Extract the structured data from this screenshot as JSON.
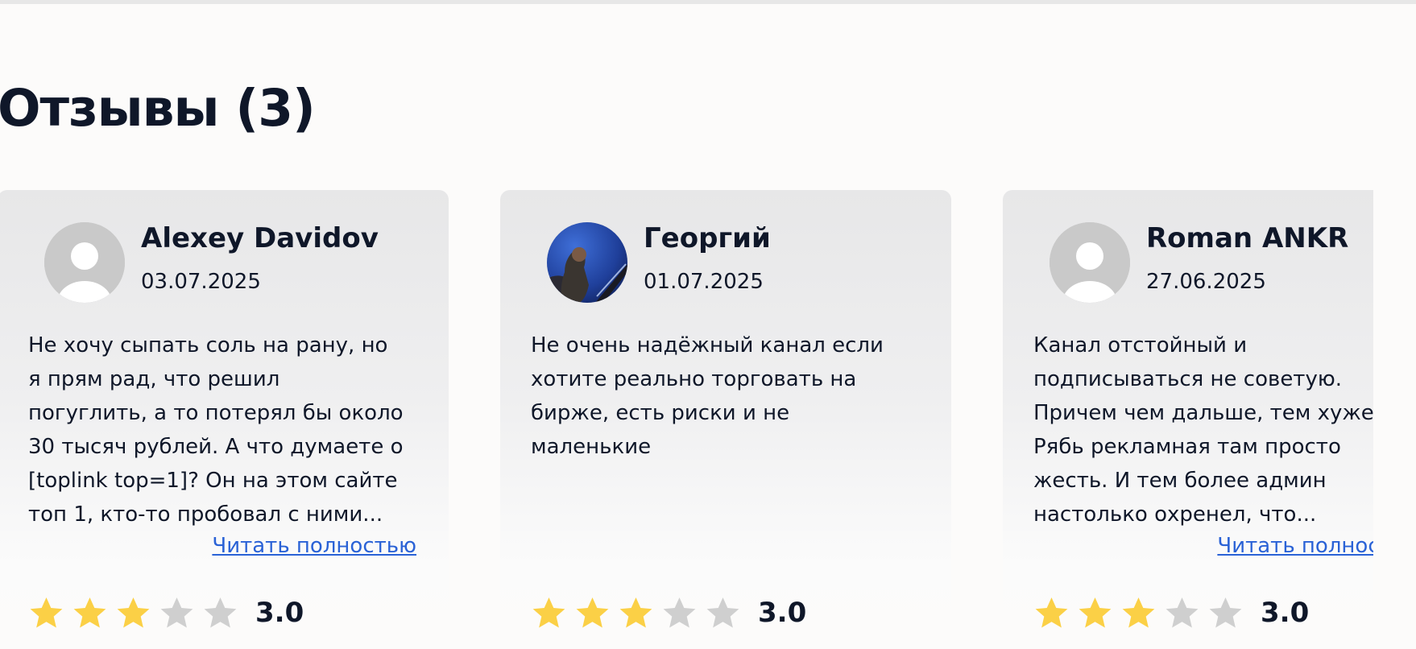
{
  "section": {
    "title": "Отзывы (3)"
  },
  "colors": {
    "star_filled": "#fbd046",
    "star_empty": "#cfcfcf",
    "link": "#2a62d6",
    "text": "#0f1729"
  },
  "reviews": [
    {
      "name": "Alexey Davidov",
      "date": "03.07.2025",
      "avatar": "default-user-icon",
      "text": "Не хочу сыпать соль на рану, но\nя прям рад, что решил\nпогуглить, а то потерял бы около\n30 тысяч рублей. А что думаете о\n[toplink top=1]? Он на этом сайте\nтоп 1, кто-то пробовал с ними...",
      "read_more": "Читать полностью",
      "rating": 3,
      "score": "3.0"
    },
    {
      "name": "Георгий",
      "date": "01.07.2025",
      "avatar": "user-photo",
      "text": "Не очень надёжный канал если\nхотите реально торговать на\nбирже, есть риски и не\nмаленькие",
      "read_more": "",
      "rating": 3,
      "score": "3.0"
    },
    {
      "name": "Roman ANKR",
      "date": "27.06.2025",
      "avatar": "default-user-icon",
      "text": "Канал отстойный и\nподписываться не советую.\nПричем чем дальше, тем хуже.\nРябь рекламная там просто\nжесть. И тем более админ\nнастолько охренел, что...",
      "read_more": "Читать полностью",
      "rating": 3,
      "score": "3.0"
    }
  ]
}
